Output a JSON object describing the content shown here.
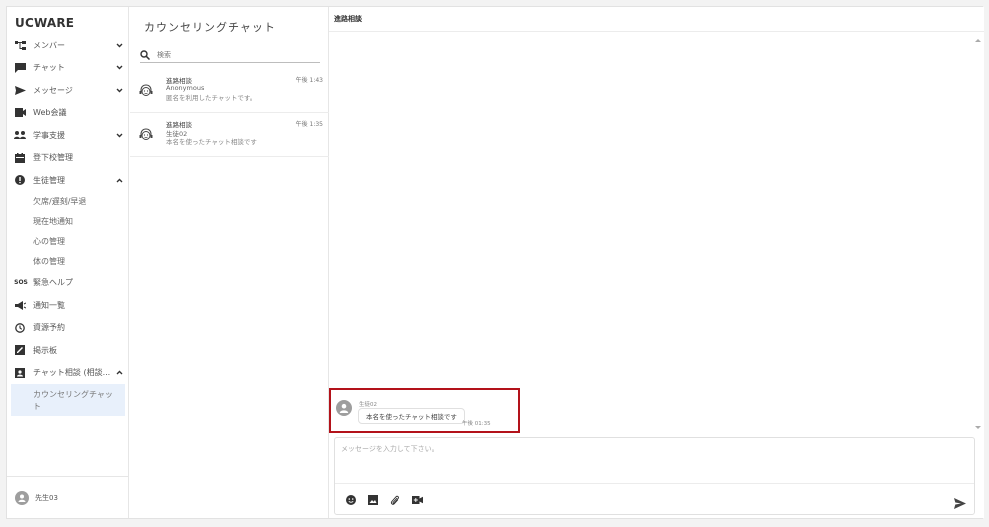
{
  "app": {
    "brand": "UCWARE"
  },
  "sidebar": {
    "items": [
      {
        "label": "メンバー",
        "icon": "org-chart-icon",
        "chevron": "down"
      },
      {
        "label": "チャット",
        "icon": "chat-icon",
        "chevron": "down"
      },
      {
        "label": "メッセージ",
        "icon": "send-icon",
        "chevron": "down"
      },
      {
        "label": "Web会議",
        "icon": "video-icon",
        "chevron": ""
      },
      {
        "label": "学事支援",
        "icon": "group-icon",
        "chevron": "down"
      },
      {
        "label": "登下校管理",
        "icon": "calendar-icon",
        "chevron": ""
      },
      {
        "label": "生徒管理",
        "icon": "alert-icon",
        "chevron": "up"
      }
    ],
    "sub_items": [
      "欠席/遅刻/早退",
      "現在地通知",
      "心の管理",
      "体の管理"
    ],
    "items_after": [
      {
        "label": "緊急ヘルプ",
        "icon": "sos-icon",
        "chevron": ""
      },
      {
        "label": "通知一覧",
        "icon": "megaphone-icon",
        "chevron": ""
      },
      {
        "label": "資源予約",
        "icon": "clock-icon",
        "chevron": ""
      },
      {
        "label": "掲示板",
        "icon": "board-icon",
        "chevron": ""
      },
      {
        "label": "チャット相談 (相談...",
        "icon": "consult-icon",
        "chevron": "up"
      }
    ],
    "active_child": "カウンセリングチャット",
    "user": "先生03"
  },
  "middle": {
    "title": "カウンセリングチャット",
    "search_placeholder": "検索",
    "threads": [
      {
        "title": "進路相談",
        "time": "午後 1:43",
        "name": "Anonymous",
        "preview": "匿名を利用したチャットです。"
      },
      {
        "title": "進路相談",
        "time": "午後 1:35",
        "name": "生徒02",
        "preview": "本名を使ったチャット相談です"
      }
    ]
  },
  "chat": {
    "header": "進路相談",
    "message": {
      "sender": "生徒02",
      "text": "本名を使ったチャット相談です",
      "time": "午後 01:35"
    },
    "compose_placeholder": "メッセージを入力して下さい。",
    "tools": [
      "emoji-icon",
      "image-icon",
      "attach-icon",
      "video-icon"
    ]
  },
  "colors": {
    "highlight": "#b3121a",
    "active_bg": "#e8f0fb"
  }
}
